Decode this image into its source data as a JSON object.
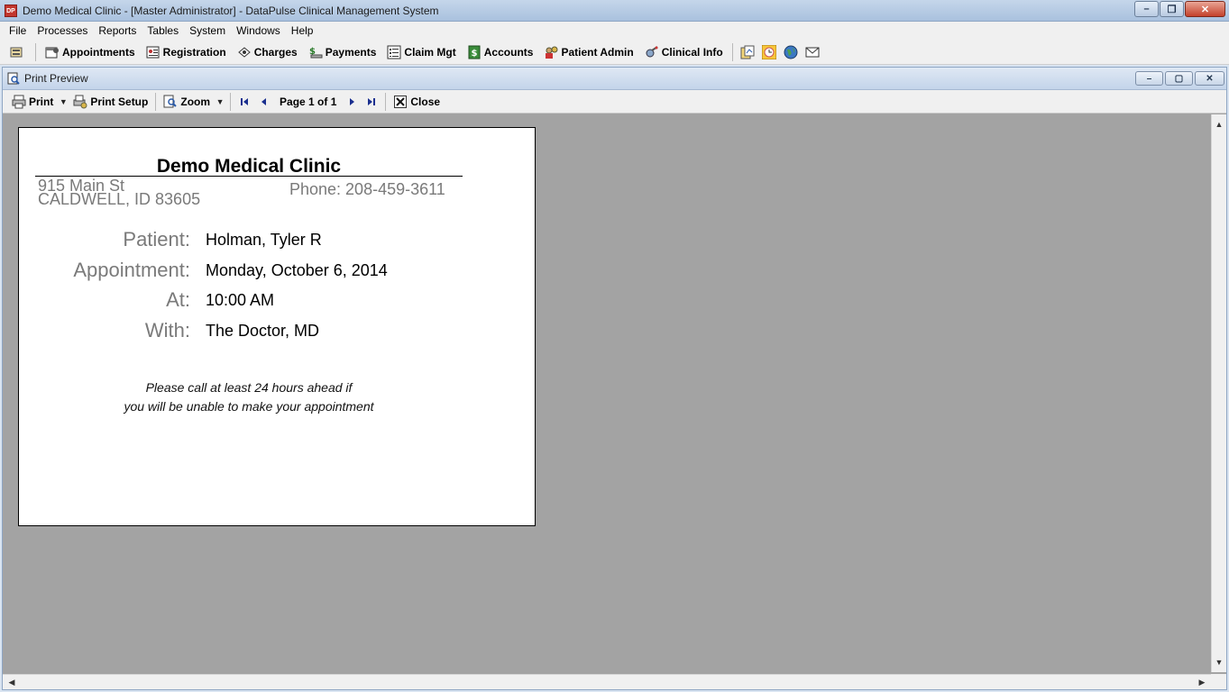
{
  "window": {
    "title": "Demo Medical Clinic - [Master Administrator] - DataPulse Clinical Management System",
    "app_icon_text": "DP",
    "minimize": "–",
    "maximize": "❐",
    "close": "✕"
  },
  "menu": [
    "File",
    "Processes",
    "Reports",
    "Tables",
    "System",
    "Windows",
    "Help"
  ],
  "toolbar": {
    "items": [
      {
        "label": "Appointments",
        "icon": "appointments-icon"
      },
      {
        "label": "Registration",
        "icon": "registration-icon"
      },
      {
        "label": "Charges",
        "icon": "charges-icon"
      },
      {
        "label": "Payments",
        "icon": "payments-icon"
      },
      {
        "label": "Claim Mgt",
        "icon": "claim-icon"
      },
      {
        "label": "Accounts",
        "icon": "accounts-icon"
      },
      {
        "label": "Patient Admin",
        "icon": "patient-admin-icon"
      },
      {
        "label": "Clinical Info",
        "icon": "clinical-info-icon"
      }
    ]
  },
  "child_window": {
    "title": "Print Preview",
    "minimize": "–",
    "maximize": "▢",
    "close": "✕"
  },
  "preview_toolbar": {
    "print": "Print",
    "print_setup": "Print Setup",
    "zoom": "Zoom",
    "page_label": "Page 1 of 1",
    "close": "Close"
  },
  "document": {
    "clinic_name": "Demo Medical Clinic",
    "address_line1": "915 Main St",
    "address_line2": "CALDWELL, ID 83605",
    "phone": "Phone: 208-459-3611",
    "patient_label": "Patient:",
    "patient_value": "Holman, Tyler R",
    "appointment_label": "Appointment:",
    "appointment_value": "Monday, October 6, 2014",
    "at_label": "At:",
    "at_value": "10:00 AM",
    "with_label": "With:",
    "with_value": "The Doctor, MD",
    "note_line1": "Please call at least 24 hours ahead if",
    "note_line2": "you will be unable to make your appointment"
  },
  "colors": {
    "title_bar": "#b5cae3",
    "preview_background": "#a3a3a3",
    "label_gray": "#7a7a7a"
  }
}
